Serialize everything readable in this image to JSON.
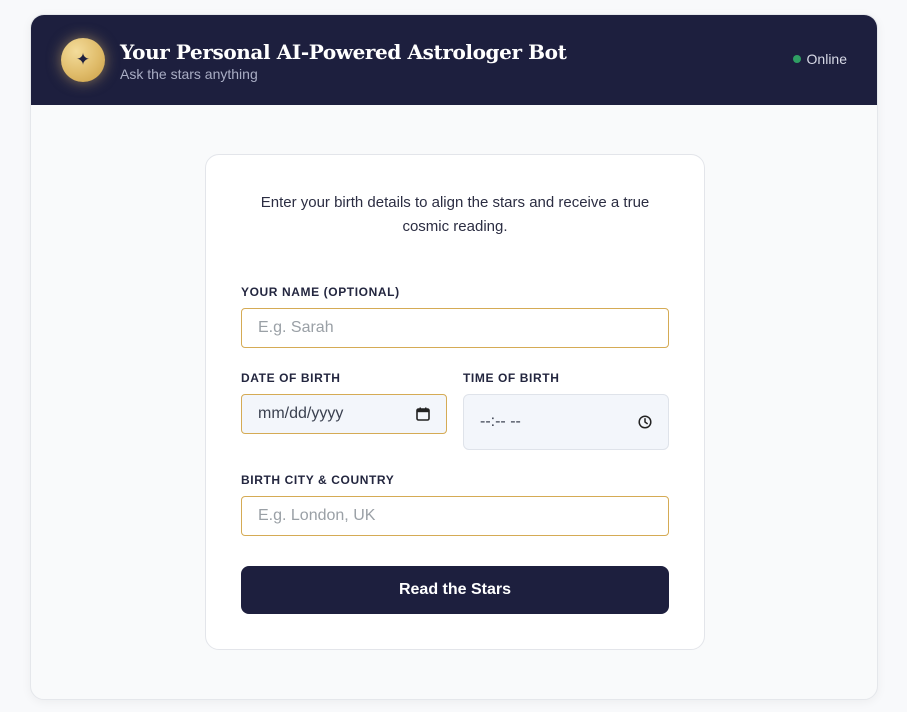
{
  "header": {
    "logo_glyph": "✦",
    "title": "Your Personal AI-Powered Astrologer Bot",
    "subtitle": "Ask the stars anything",
    "status": "Online",
    "status_color": "#2f9e63"
  },
  "form": {
    "intro": "Enter your birth details to align the stars and receive a true cosmic reading.",
    "name": {
      "label": "Your Name (Optional)",
      "placeholder": "E.g. Sarah"
    },
    "dob": {
      "label": "Date of Birth",
      "placeholder": "mm/dd/yyyy"
    },
    "tob": {
      "label": "Time of Birth",
      "placeholder": "--:-- --"
    },
    "city": {
      "label": "Birth City & Country",
      "placeholder": "E.g. London, UK"
    },
    "submit_label": "Read the Stars"
  },
  "colors": {
    "header_bg": "#1d1f3e",
    "accent_gold": "#d5ab55"
  }
}
